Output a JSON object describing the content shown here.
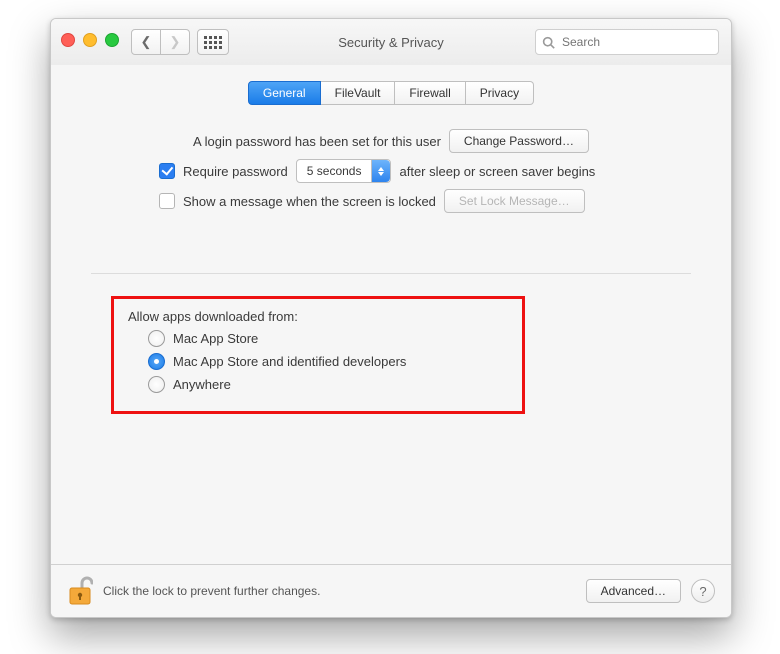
{
  "window": {
    "title": "Security & Privacy"
  },
  "search": {
    "placeholder": "Search"
  },
  "tabs": {
    "general": "General",
    "filevault": "FileVault",
    "firewall": "Firewall",
    "privacy": "Privacy",
    "active": "general"
  },
  "general": {
    "login_password_set": "A login password has been set for this user",
    "change_password": "Change Password…",
    "require_password_label": "Require password",
    "require_password_checked": true,
    "delay": {
      "value": "5 seconds"
    },
    "after_sleep": "after sleep or screen saver begins",
    "show_message_label": "Show a message when the screen is locked",
    "show_message_checked": false,
    "set_lock_message": "Set Lock Message…"
  },
  "gatekeeper": {
    "header": "Allow apps downloaded from:",
    "options": [
      "Mac App Store",
      "Mac App Store and identified developers",
      "Anywhere"
    ],
    "selected": 1
  },
  "footer": {
    "lock_text": "Click the lock to prevent further changes.",
    "advanced": "Advanced…"
  }
}
